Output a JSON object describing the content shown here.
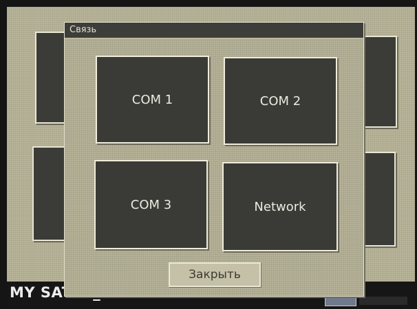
{
  "dialog": {
    "title": "Связь",
    "buttons": [
      {
        "label": "COM 1"
      },
      {
        "label": "COM 2"
      },
      {
        "label": "COM 3"
      },
      {
        "label": "Network"
      }
    ],
    "close_label": "Закрыть"
  },
  "status_bar": {
    "text": "MY SATEC_"
  },
  "colors": {
    "screen_background": "#b8b59a",
    "tile_background": "#3a3a37",
    "tile_border": "#f0eddc",
    "titlebar_background": "#3d3d39",
    "status_bar_background": "#161616"
  }
}
